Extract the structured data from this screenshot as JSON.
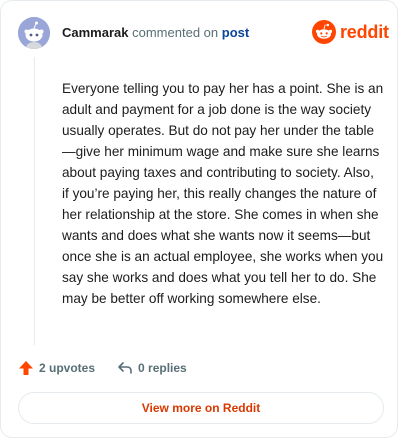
{
  "header": {
    "author": "Cammarak",
    "action_text": "commented on",
    "post_link": "post"
  },
  "brand": {
    "name": "reddit",
    "logo_icon": "reddit-snoo-icon",
    "color": "#ff4500"
  },
  "comment": {
    "body": "Everyone telling you to pay her has a point. She is an adult and payment for a job done is the way society usually operates. But do not pay her under the table—give her minimum wage and make sure she learns about paying taxes and contributing to society. Also, if you’re paying her, this really changes the nature of her relationship at the store. She comes in when she wants and does what she wants now it seems—but once she is an actual employee, she works when you say she works and does what you tell her to do. She may be better off working somewhere else."
  },
  "actions": {
    "upvotes": "2 upvotes",
    "replies": "0 replies"
  },
  "footer": {
    "view_more": "View more on Reddit"
  }
}
